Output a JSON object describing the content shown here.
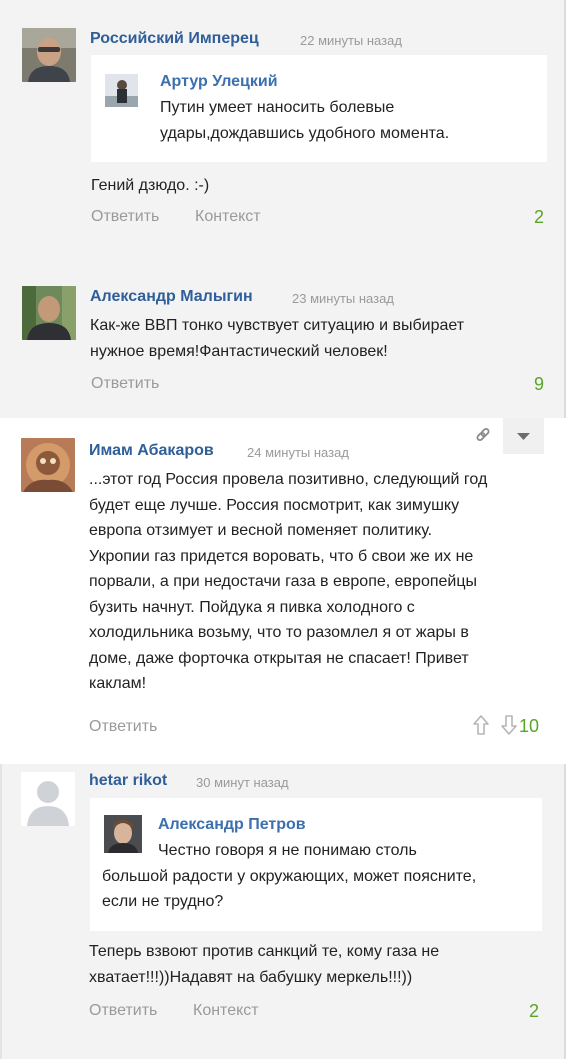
{
  "comments": [
    {
      "author": "Российский Имперец",
      "time": "22 минуты назад",
      "quote": {
        "author": "Артур Улецкий",
        "lines": [
          "Путин умеет наносить болевые",
          "удары,дождавшись удобного момента."
        ]
      },
      "lines": [
        "Гений дзюдо. :-)"
      ],
      "actions": {
        "reply": "Ответить",
        "context": "Контекст"
      },
      "score": "2"
    },
    {
      "author": "Александр Малыгин",
      "time": "23 минуты назад",
      "lines": [
        "Как-же ВВП тонко чувствует ситуацию и выбирает",
        "нужное время!Фантастический человек!"
      ],
      "actions": {
        "reply": "Ответить"
      },
      "score": "9"
    },
    {
      "author": "Имам Абакаров",
      "time": "24 минуты назад",
      "lines": [
        "...этот год Россия провела позитивно, следующий год",
        "будет еще лучше. Россия посмотрит, как зимушку",
        "европа отзимует и весной поменяет политику.",
        "Укропии газ придется воровать, что б свои же их не",
        "порвали, а при недостачи газа в европе, европейцы",
        "бузить начнут. Пойдука я пивка холодного с",
        "холодильника возьму, что то разомлел я от жары в",
        "доме, даже форточка открытая не спасает! Привет",
        "каклам!"
      ],
      "actions": {
        "reply": "Ответить"
      },
      "score": "10",
      "icons": {
        "permalink": "link-icon",
        "menu": "chevron-down-icon",
        "up": "arrow-up-icon",
        "down": "arrow-down-icon"
      }
    },
    {
      "author": "hetar rikot",
      "time": "30 минут назад",
      "quote": {
        "author": "Александр Петров",
        "lines": [
          "Честно говоря я не понимаю столь",
          "большой радости у окружающих, может поясните,",
          "если не трудно?"
        ]
      },
      "lines": [
        "Теперь взвоют против санкций те, кому газа не",
        "хватает!!!))Надавят на бабушку меркель!!!))"
      ],
      "actions": {
        "reply": "Ответить",
        "context": "Контекст"
      },
      "score": "2"
    }
  ]
}
